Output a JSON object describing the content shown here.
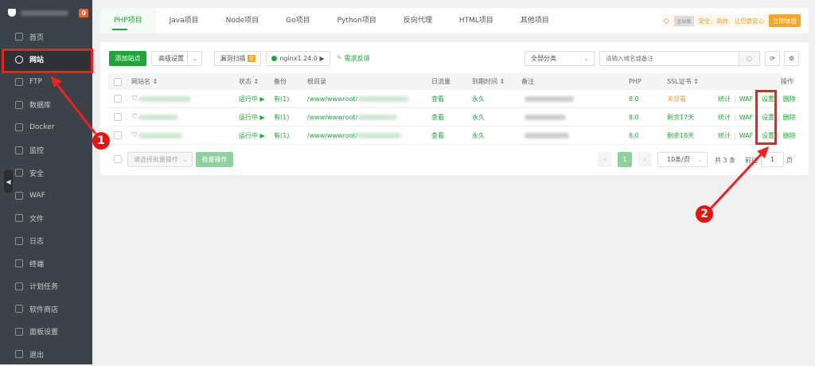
{
  "sidebar": {
    "badge": "0",
    "items": [
      {
        "label": "首页",
        "icon": "home-icon"
      },
      {
        "label": "网站",
        "icon": "globe-icon",
        "active": true
      },
      {
        "label": "FTP",
        "icon": "ftp-icon"
      },
      {
        "label": "数据库",
        "icon": "database-icon"
      },
      {
        "label": "Docker",
        "icon": "docker-icon"
      },
      {
        "label": "监控",
        "icon": "monitor-icon"
      },
      {
        "label": "安全",
        "icon": "shield-icon"
      },
      {
        "label": "WAF",
        "icon": "waf-icon"
      },
      {
        "label": "文件",
        "icon": "folder-icon"
      },
      {
        "label": "日志",
        "icon": "log-icon"
      },
      {
        "label": "终端",
        "icon": "terminal-icon"
      },
      {
        "label": "计划任务",
        "icon": "calendar-icon"
      },
      {
        "label": "软件商店",
        "icon": "apps-icon"
      },
      {
        "label": "面板设置",
        "icon": "gear-icon"
      },
      {
        "label": "退出",
        "icon": "logout-icon"
      }
    ]
  },
  "tabs": [
    "PHP项目",
    "Java项目",
    "Node项目",
    "Go项目",
    "Python项目",
    "反向代理",
    "HTML项目",
    "其他项目"
  ],
  "promo": {
    "edition": "企业版",
    "text": "安全、高效、让您更安心",
    "button": "立即体验"
  },
  "toolbar": {
    "add_site": "添加站点",
    "advanced": "高级设置",
    "vuln_scan": "漏洞扫描",
    "vuln_count": "0",
    "nginx": "nginx1.24.0 ▶",
    "feedback": "需求反馈",
    "category": "全部分类",
    "search_placeholder": "请输入域名或备注"
  },
  "table": {
    "headers": {
      "name": "网站名",
      "status": "状态",
      "backup": "备份",
      "root": "根目录",
      "traffic": "日流量",
      "expire": "到期时间",
      "remark": "备注",
      "php": "PHP",
      "ssl": "SSL证书",
      "ops": "操作"
    },
    "rows": [
      {
        "status": "运行中 ▶",
        "backup": "有(1)",
        "root": "/www/wwwroot/",
        "traffic": "查看",
        "expire": "永久",
        "php": "8.0",
        "ssl": "未部署",
        "ssl_state": "warn"
      },
      {
        "status": "运行中 ▶",
        "backup": "有(1)",
        "root": "/www/wwwroot/",
        "traffic": "查看",
        "expire": "永久",
        "php": "8.0",
        "ssl": "剩余17天",
        "ssl_state": "ok"
      },
      {
        "status": "运行中 ▶",
        "backup": "有(1)",
        "root": "/www/wwwroot/",
        "traffic": "查看",
        "expire": "永久",
        "php": "8.0",
        "ssl": "剩余18天",
        "ssl_state": "ok"
      }
    ],
    "actions": {
      "stats": "统计",
      "waf": "WAF",
      "settings": "设置",
      "delete": "删除"
    }
  },
  "footer": {
    "batch_placeholder": "请选择批量操作",
    "batch_button": "批量操作",
    "page": "1",
    "per_page": "10条/页",
    "total": "共 3 条",
    "goto": "前往",
    "goto_value": "1",
    "page_unit": "页"
  },
  "annotations": {
    "step1": "1",
    "step2": "2",
    "color": "#f02020"
  }
}
